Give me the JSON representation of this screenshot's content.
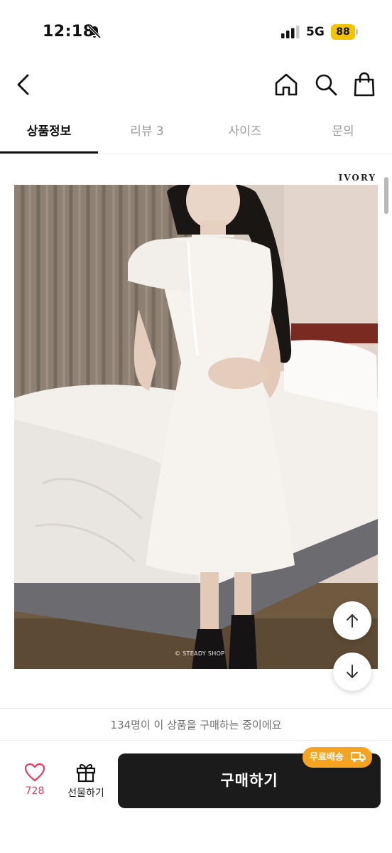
{
  "status_bar": {
    "time": "12:18",
    "network": "5G",
    "battery": "88",
    "battery_color": "#f5c400"
  },
  "top_nav": {
    "icons": [
      "back-arrow-icon",
      "home-icon",
      "search-icon",
      "shopping-bag-icon"
    ]
  },
  "tabs": [
    {
      "label": "상품정보",
      "active": true
    },
    {
      "label": "리뷰 3",
      "active": false
    },
    {
      "label": "사이즈",
      "active": false
    },
    {
      "label": "문의",
      "active": false
    }
  ],
  "product": {
    "color_label": "IVORY",
    "watermark": "© STEADY SHOP"
  },
  "purchase_notice": "134명이 이 상품을 구매하는 중이에요",
  "bottom_bar": {
    "like_count": "728",
    "gift_label": "선물하기",
    "buy_label": "구매하기",
    "shipping_badge": "무료배송",
    "accent_color": "#f6a31f",
    "like_color": "#e83a5a"
  }
}
